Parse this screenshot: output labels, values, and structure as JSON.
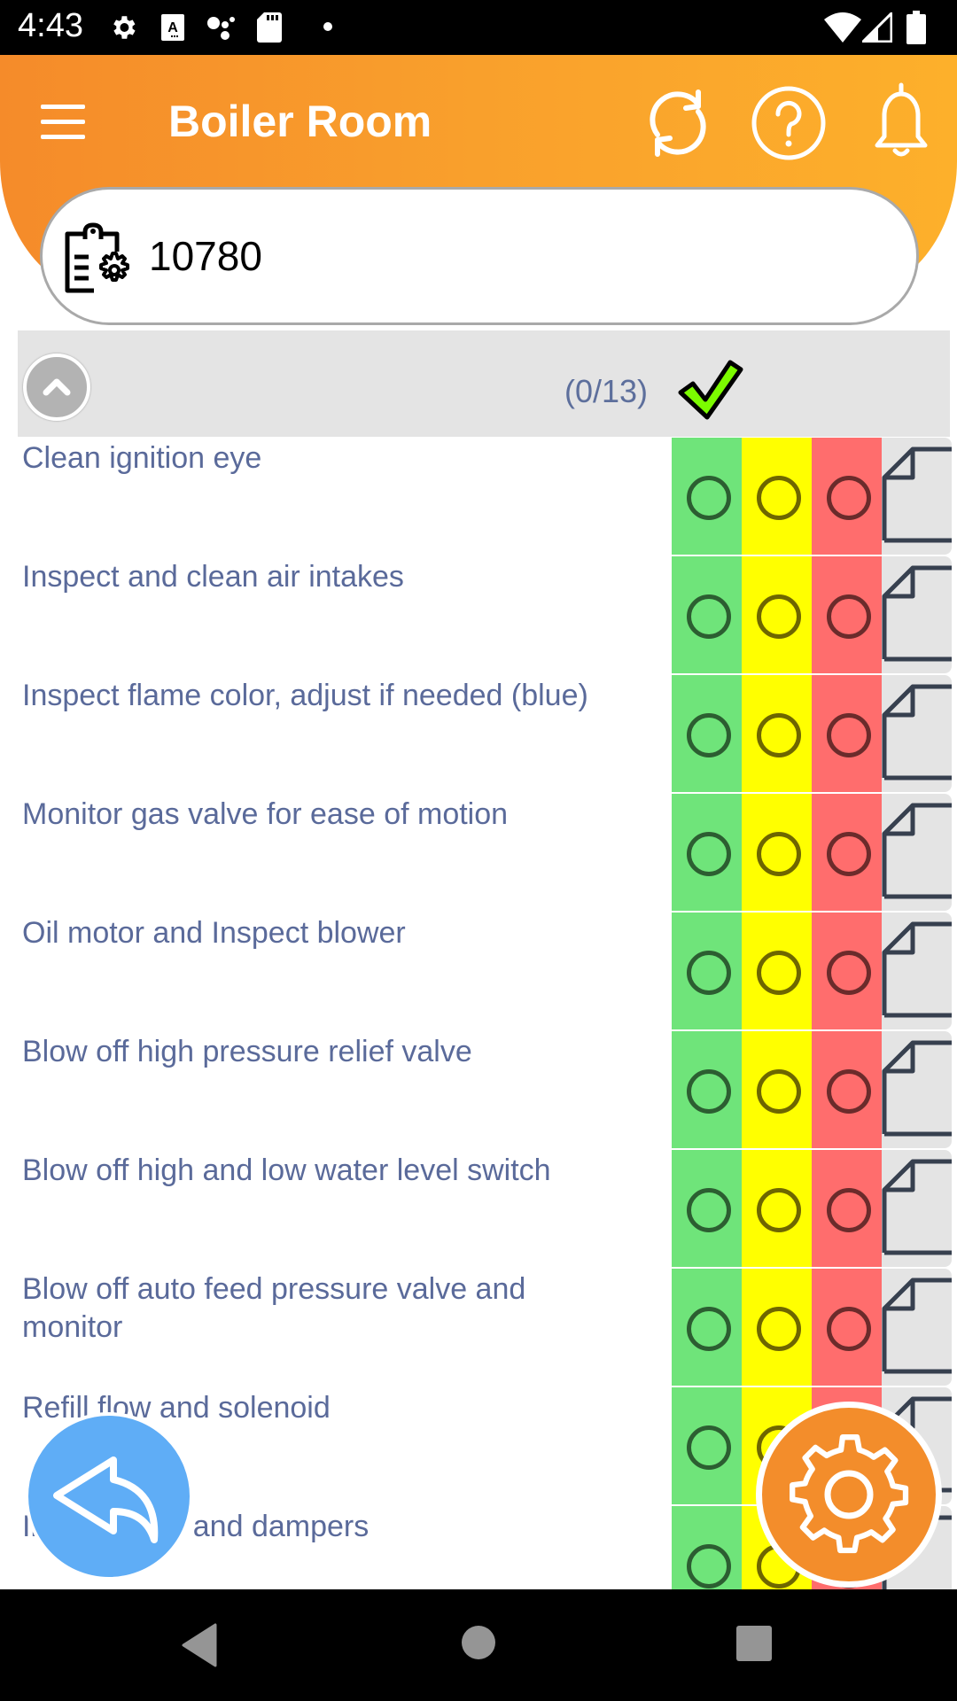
{
  "status_bar": {
    "time": "4:43",
    "left_icons": [
      "settings-icon",
      "font-a-icon",
      "assistant-dots-icon",
      "sd-card-icon",
      "notification-dot-icon"
    ],
    "right_icons": [
      "wifi-icon",
      "cell-signal-icon",
      "battery-icon"
    ]
  },
  "header": {
    "title": "Boiler Room",
    "menu_icon": "hamburger-menu-icon",
    "actions": [
      {
        "name": "sync",
        "icon": "sync-icon"
      },
      {
        "name": "help",
        "icon": "help-circle-icon"
      },
      {
        "name": "notifications",
        "icon": "bell-icon"
      }
    ]
  },
  "work_order": {
    "icon": "clipboard-gear-icon",
    "value": "10780"
  },
  "section": {
    "progress": "(0/13)",
    "completed": 0,
    "total": 13,
    "collapse_icon": "chevron-up-icon",
    "status_icon": "checkmark-icon"
  },
  "colors": {
    "brand_orange": "#f58b2a",
    "accent_yellow_orange": "#fdb02b",
    "pass_green": "#6fe47a",
    "warn_yellow": "#ffff00",
    "fail_red": "#ff6d6d",
    "task_text": "#5a6a9a",
    "back_blue": "#5fadf6"
  },
  "tasks": [
    {
      "label": "Clean ignition eye",
      "status": null
    },
    {
      "label": "Inspect and clean air intakes",
      "status": null
    },
    {
      "label": "Inspect flame color, adjust if needed (blue)",
      "status": null
    },
    {
      "label": "Monitor gas valve for ease of motion",
      "status": null
    },
    {
      "label": "Oil motor and Inspect blower",
      "status": null
    },
    {
      "label": "Blow off high pressure relief valve",
      "status": null
    },
    {
      "label": "Blow off high and low water level switch",
      "status": null
    },
    {
      "label": "Blow off auto feed pressure valve and monitor",
      "status": null
    },
    {
      "label": "Refill flow and solenoid",
      "status": null
    },
    {
      "label": "Inspect fans and dampers",
      "status": null
    }
  ],
  "fabs": {
    "back": {
      "icon": "reply-arrow-icon"
    },
    "settings": {
      "icon": "gear-icon"
    }
  },
  "nav_bar": {
    "buttons": [
      "back-triangle-icon",
      "home-circle-icon",
      "recents-square-icon"
    ]
  }
}
